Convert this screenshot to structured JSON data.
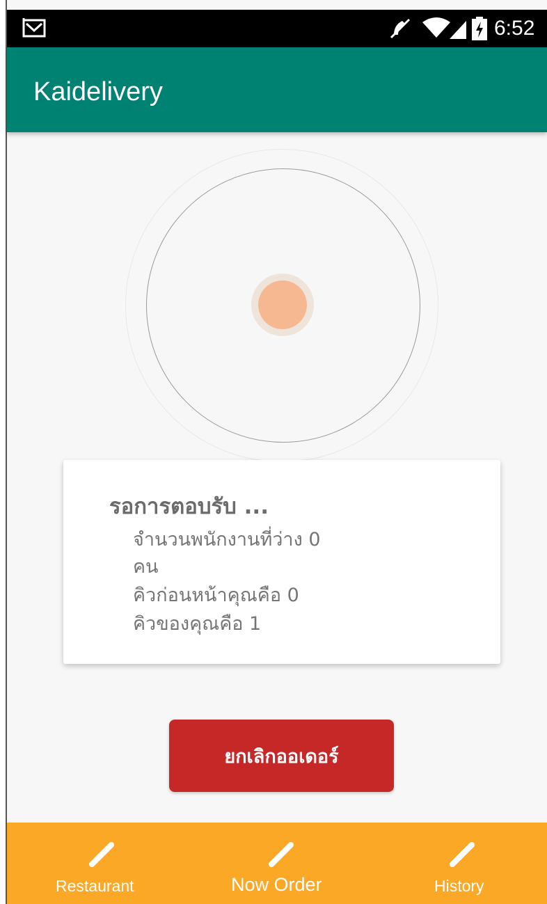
{
  "status_bar": {
    "time": "6:52",
    "icons": [
      "gmail-icon",
      "mute-icon",
      "wifi-icon",
      "signal-icon",
      "battery-charging-icon"
    ]
  },
  "app_bar": {
    "title": "Kaidelivery"
  },
  "colors": {
    "primary": "#008272",
    "accent_nav": "#fba827",
    "cancel": "#c62828",
    "radar_dot": "#f6b891"
  },
  "status_card": {
    "title": "รอการตอบรับ ...",
    "line1": "จำนวนพนักงานที่ว่าง 0",
    "line2": "คน",
    "line3": "คิวก่อนหน้าคุณคือ 0",
    "line4": "คิวของคุณคือ 1"
  },
  "cancel_button": {
    "label": "ยกเลิกออเดอร์"
  },
  "bottom_nav": {
    "items": [
      {
        "label": "Restaurant",
        "icon": "pencil-icon"
      },
      {
        "label": "Now Order",
        "icon": "pencil-icon"
      },
      {
        "label": "History",
        "icon": "pencil-icon"
      }
    ]
  }
}
